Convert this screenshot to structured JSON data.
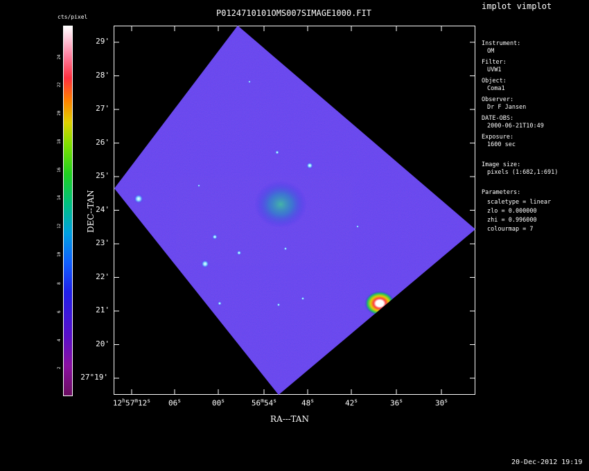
{
  "header": {
    "title": "P0124710101OMS007SIMAGE1000.FIT",
    "app_label": "implot vimplot"
  },
  "colorbar": {
    "unit_label": "cts/pixel",
    "ticks": [
      "2",
      "4",
      "6",
      "8",
      "10",
      "12",
      "14",
      "16",
      "18",
      "20",
      "22",
      "24"
    ]
  },
  "axes": {
    "xlabel": "RA---TAN",
    "ylabel": "DEC--TAN",
    "yticks": [
      "29'",
      "28'",
      "27'",
      "26'",
      "25'",
      "24'",
      "23'",
      "22'",
      "21'",
      "20'",
      "27°19'"
    ],
    "xticks": [
      {
        "main": "12",
        "h": "h",
        "m_val": "57",
        "m": "m",
        "s_val": "12",
        "s": "s"
      },
      {
        "main": "06",
        "s": "s"
      },
      {
        "main": "00",
        "s": "s"
      },
      {
        "main": "56",
        "m": "m",
        "s_val": "54",
        "s": "s"
      },
      {
        "main": "48",
        "s": "s"
      },
      {
        "main": "42",
        "s": "s"
      },
      {
        "main": "36",
        "s": "s"
      },
      {
        "main": "30",
        "s": "s"
      }
    ]
  },
  "metadata": {
    "instrument_label": "Instrument:",
    "instrument": "OM",
    "filter_label": "Filter:",
    "filter": "UVW1",
    "object_label": "Object:",
    "object": "Coma1",
    "observer_label": "Observer:",
    "observer": "Dr F Jansen",
    "date_label": "DATE-OBS:",
    "date": "2000-06-21T10:49",
    "exposure_label": "Exposure:",
    "exposure": "1600 sec",
    "imgsize_label": "Image size:",
    "imgsize": "pixels (1:682,1:691)",
    "params_label": "Parameters:",
    "scaletype": "scaletype = linear",
    "zlo": "zlo = 0.000000",
    "zhi": "zhi = 0.996000",
    "colourmap": "colourmap =   7"
  },
  "footer": {
    "timestamp": "20-Dec-2012 19:19"
  },
  "colors": {
    "background": "#000000",
    "field": "#2b22ee",
    "frame": "#ffffff"
  }
}
